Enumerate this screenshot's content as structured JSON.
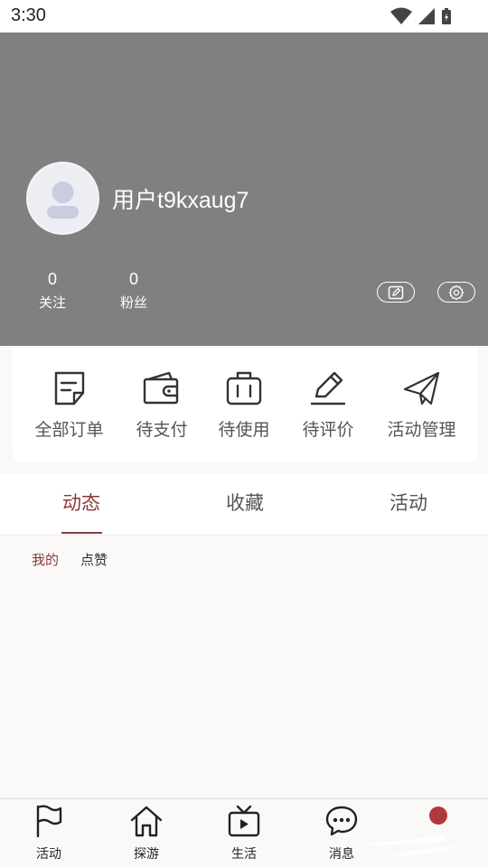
{
  "status_bar": {
    "time": "3:30"
  },
  "profile": {
    "username": "用户t9kxaug7",
    "stats": [
      {
        "value": "0",
        "label": "关注"
      },
      {
        "value": "0",
        "label": "粉丝"
      }
    ],
    "buttons": {
      "edit_icon": "edit-icon",
      "settings_icon": "gear-icon"
    }
  },
  "orders": [
    {
      "label": "全部订单",
      "icon": "order-list-icon"
    },
    {
      "label": "待支付",
      "icon": "wallet-icon"
    },
    {
      "label": "待使用",
      "icon": "briefcase-icon"
    },
    {
      "label": "待评价",
      "icon": "pen-icon"
    },
    {
      "label": "活动管理",
      "icon": "paper-plane-icon"
    }
  ],
  "tabs": [
    {
      "label": "动态",
      "active": true
    },
    {
      "label": "收藏",
      "active": false
    },
    {
      "label": "活动",
      "active": false
    }
  ],
  "subtabs": [
    {
      "label": "我的",
      "active": true
    },
    {
      "label": "点赞",
      "active": false
    }
  ],
  "bottom_nav": [
    {
      "label": "活动",
      "icon": "flag-icon"
    },
    {
      "label": "探游",
      "icon": "home-icon"
    },
    {
      "label": "生活",
      "icon": "tv-icon"
    },
    {
      "label": "消息",
      "icon": "chat-icon"
    },
    {
      "label": "",
      "icon": "profile-dot"
    }
  ],
  "colors": {
    "header_bg": "#808080",
    "accent": "#8b3a3a",
    "nav_dot": "#b03a3a",
    "page_bg": "#faf9f7"
  }
}
